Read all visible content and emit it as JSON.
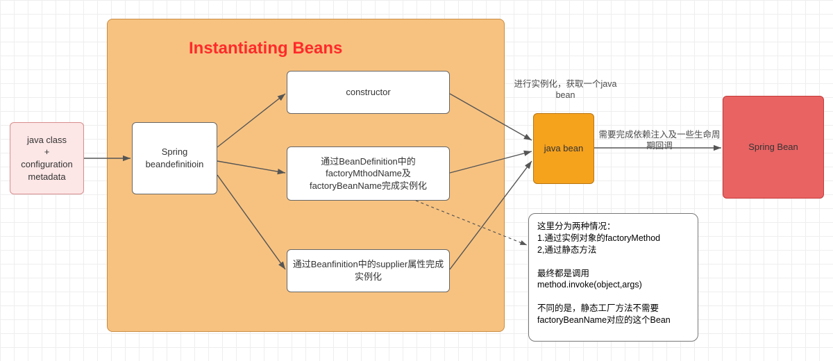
{
  "diagram": {
    "title": "Instantiating Beans",
    "input_box": "java class\n+\nconfiguration\nmetadata",
    "bean_def_box": "Spring\nbeandefinitioin",
    "option1": "constructor",
    "option2": "通过BeanDefinition中的\nfactoryMthodName及\nfactoryBeanName完成实例化",
    "option3": "通过Beanfinition中的supplier属性完成实例化",
    "java_bean": "java bean",
    "spring_bean": "Spring Bean",
    "label_instantiate": "进行实例化，获取一个java\nbean",
    "label_di": "需要完成依赖注入及一些生命周期回调",
    "note": "这里分为两种情况：\n1.通过实例对象的factoryMethod\n2,通过静态方法\n\n最终都是调用\nmethod.invoke(object,args)\n\n不同的是，静态工厂方法不需要factoryBeanName对应的这个Bean"
  }
}
